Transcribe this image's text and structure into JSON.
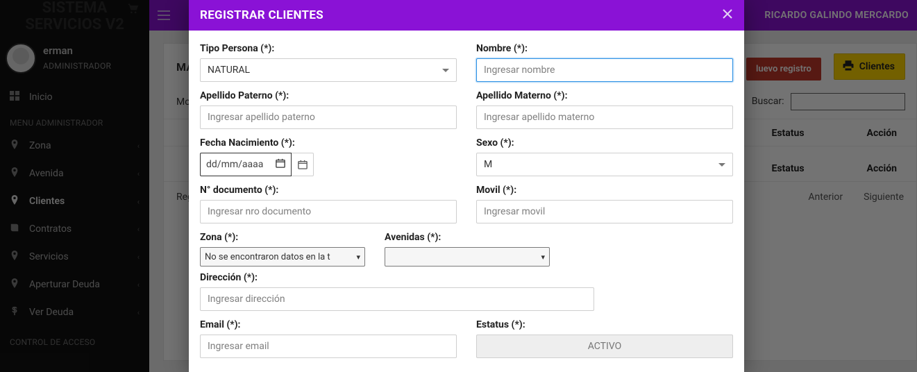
{
  "brand": {
    "line1": "SISTEMA",
    "line2": "SERVICIOS V2"
  },
  "profile": {
    "name": "erman",
    "role": "ADMINISTRADOR"
  },
  "sections": {
    "admin": "MENU ADMINISTRADOR",
    "control": "CONTROL DE ACCESO"
  },
  "nav": {
    "inicio": "Inicio",
    "zona": "Zona",
    "avenida": "Avenida",
    "clientes": "Clientes",
    "contratos": "Contratos",
    "servicios": "Servicios",
    "aperturar": "Aperturar Deuda",
    "verdeuda": "Ver Deuda"
  },
  "topbar": {
    "username": "RICARDO GALINDO MERCARDO"
  },
  "page": {
    "title": "MA",
    "showPrefix": "Mo",
    "searchLabel": "Buscar:",
    "btnNew": "luevo registro",
    "btnClientes": "Clientes",
    "col1": "Estatus",
    "col2": "Acción",
    "regLine": "Reg",
    "prev": "Anterior",
    "next": "Siguiente"
  },
  "modal": {
    "title": "REGISTRAR CLIENTES",
    "fields": {
      "tipoPersona": {
        "label": "Tipo Persona (*):",
        "value": "NATURAL"
      },
      "nombre": {
        "label": "Nombre (*):",
        "placeholder": "Ingresar nombre"
      },
      "apPaterno": {
        "label": "Apellido Paterno (*):",
        "placeholder": "Ingresar apellido paterno"
      },
      "apMaterno": {
        "label": "Apellido Materno (*):",
        "placeholder": "Ingresar apellido materno"
      },
      "fnac": {
        "label": "Fecha Nacimiento (*):",
        "placeholder": "dd/mm/aaaa"
      },
      "sexo": {
        "label": "Sexo (*):",
        "value": "M"
      },
      "ndoc": {
        "label": "N° documento (*):",
        "placeholder": "Ingresar nro documento"
      },
      "movil": {
        "label": "Movil (*):",
        "placeholder": "Ingresar movil"
      },
      "zona": {
        "label": "Zona (*):",
        "value": "No se encontraron datos en la t"
      },
      "avenidas": {
        "label": "Avenidas (*):",
        "value": ""
      },
      "direccion": {
        "label": "Dirección (*):",
        "placeholder": "Ingresar dirección"
      },
      "email": {
        "label": "Email (*):",
        "placeholder": "Ingresar email"
      },
      "estatus": {
        "label": "Estatus (*):",
        "value": "ACTIVO"
      }
    }
  }
}
